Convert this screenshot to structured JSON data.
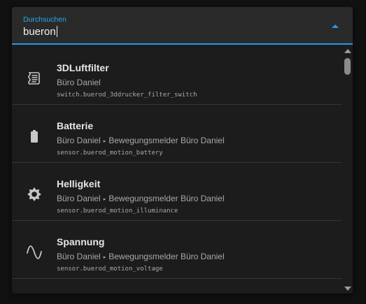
{
  "search": {
    "label": "Durchsuchen",
    "value": "bueron"
  },
  "colors": {
    "accent": "#1e9ce6",
    "background": "#1c1c1c",
    "field": "#2a2a2a"
  },
  "results": [
    {
      "icon": "air-filter-icon",
      "title": "3DLuftfilter",
      "area": "Büro Daniel",
      "device": "",
      "entity_id": "switch.buerod_3ddrucker_filter_switch"
    },
    {
      "icon": "battery-icon",
      "title": "Batterie",
      "area": "Büro Daniel",
      "device": "Bewegungsmelder Büro Daniel",
      "entity_id": "sensor.buerod_motion_battery"
    },
    {
      "icon": "brightness-icon",
      "title": "Helligkeit",
      "area": "Büro Daniel",
      "device": "Bewegungsmelder Büro Daniel",
      "entity_id": "sensor.buerod_motion_illuminance"
    },
    {
      "icon": "sine-wave-icon",
      "title": "Spannung",
      "area": "Büro Daniel",
      "device": "Bewegungsmelder Büro Daniel",
      "entity_id": "sensor.buerod_motion_voltage"
    }
  ],
  "separator_glyph": "▸"
}
